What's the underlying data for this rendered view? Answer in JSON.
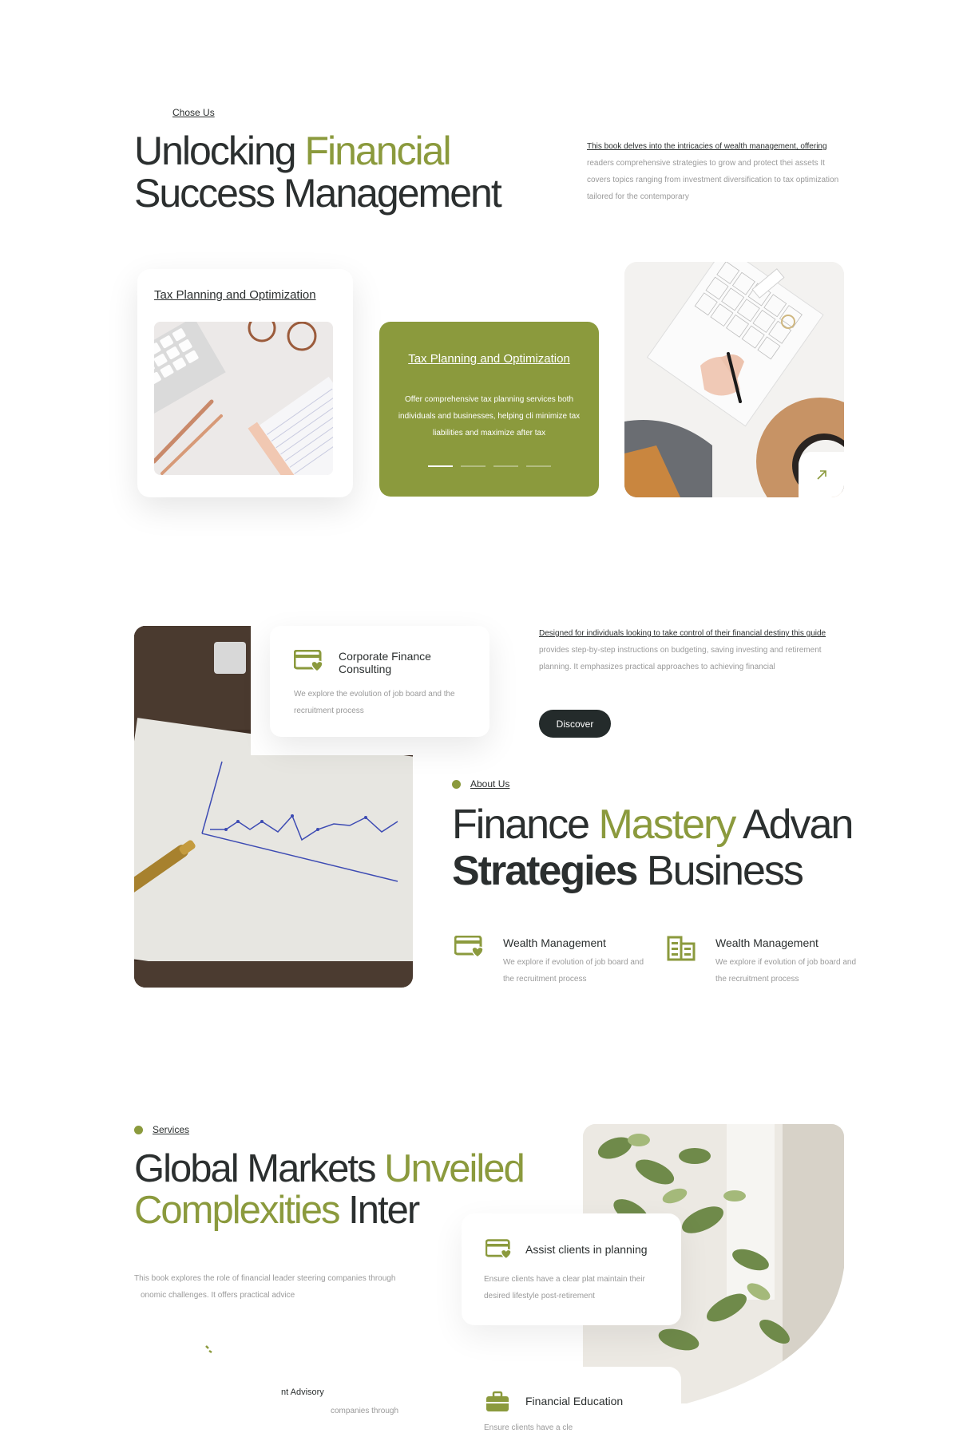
{
  "section1": {
    "eyebrow": "Chose Us",
    "heading_line1_plain": "Unlocking ",
    "heading_line1_accent": "Financial",
    "heading_line2_plain": "Success ",
    "heading_line2_dark": "Management",
    "intro_underlined": "This book delves into the intricacies of wealth management, offering",
    "intro_rest": "readers comprehensive strategies to grow and protect thei assets It covers topics ranging from investment diversification to tax optimization tailored for the contemporary",
    "card_white_title": "Tax Planning and Optimization",
    "card_green": {
      "title": "Tax Planning and Optimization",
      "description": "Offer comprehensive tax planning services both individuals and businesses, helping cli minimize tax liabilities and maximize after tax"
    },
    "pager_count": 4,
    "pager_active": 1,
    "arrow_icon": "arrow-up-right"
  },
  "section2": {
    "consult_card": {
      "title": "Corporate Finance Consulting",
      "description": "We explore the evolution of job board and the recruitment process"
    },
    "intro_underlined": "Designed for individuals looking to take control of their financial destiny this guide",
    "intro_rest": "provides step-by-step instructions on budgeting, saving investing and retirement planning. It emphasizes practical approaches to achieving financial",
    "discover_label": "Discover",
    "eyebrow": "About Us",
    "heading_l1_plain": "Finance ",
    "heading_l1_accent": "Mastery",
    "heading_l1_rest": " Advan",
    "heading_l2_bold": "Strategies",
    "heading_l2_rest": " Business",
    "features": [
      {
        "title": "Wealth Management",
        "description": "We explore if evolution of job board and the recruitment process",
        "icon": "card-heart-icon"
      },
      {
        "title": "Wealth Management",
        "description": "We explore if evolution of job board and the recruitment process",
        "icon": "building-icon"
      }
    ]
  },
  "section3": {
    "eyebrow": "Services",
    "heading_l1_plain": "Global Markets ",
    "heading_l1_accent": "Unveiled",
    "heading_l2_accent": "Complexities",
    "heading_l2_rest": " Inter",
    "intro": "This book explores the role of financial leader steering companies through ",
    "intro_line2": "onomic challenges. It offers practical advice",
    "assist_card": {
      "title": "Assist clients in planning",
      "description": "Ensure clients have a clear plat maintain their desired lifestyle post-retirement"
    },
    "edu_card": {
      "title": "Financial Education",
      "description": "Ensure clients have a cle"
    },
    "fragment_title": "nt Advisory",
    "fragment_desc": "companies through"
  },
  "colors": {
    "accent": "#8b9a3d",
    "dark": "#242b2b",
    "muted": "#9a9a9a"
  }
}
